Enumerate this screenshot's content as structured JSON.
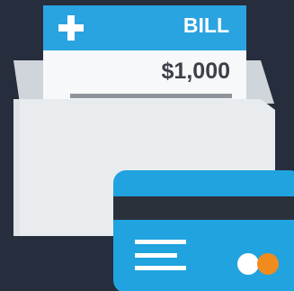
{
  "bill": {
    "title": "BILL",
    "amount": "$1,000",
    "header_icon": "plus-icon"
  },
  "colors": {
    "background": "#262e3d",
    "accent_blue": "#2aa4e0",
    "envelope": "#e9ecef",
    "card_blue": "#20a3df",
    "card_stripe": "#2b313b",
    "card_logo_white": "#ffffff",
    "card_logo_orange": "#f28b1e"
  },
  "card": {
    "logo_icon": "card-network-logo-icon"
  }
}
